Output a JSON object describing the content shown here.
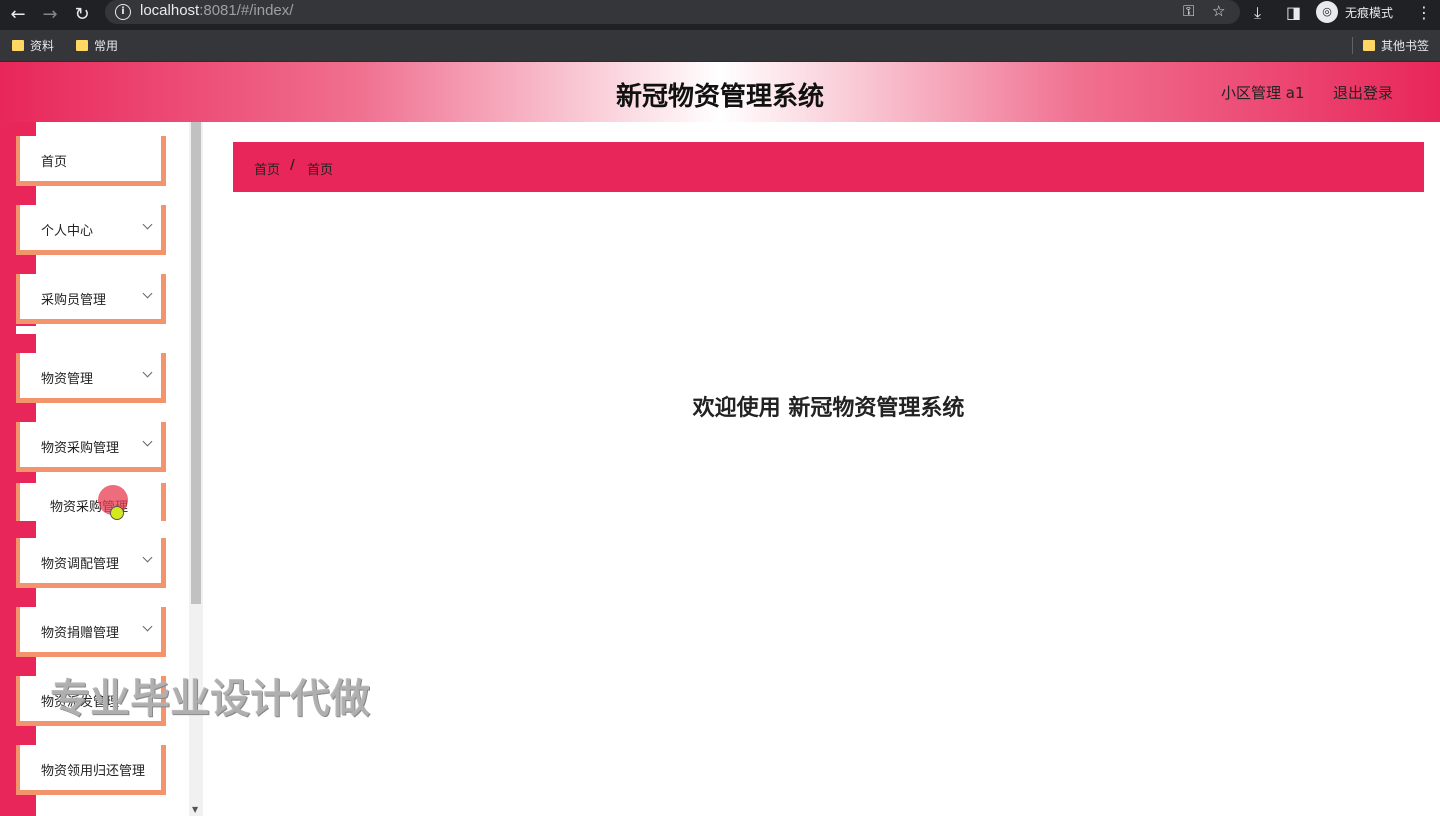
{
  "browser": {
    "url_host": "localhost",
    "url_rest": ":8081/#/index/",
    "incognito_label": "无痕模式",
    "bookmarks": [
      "资料",
      "常用"
    ],
    "other_bookmarks": "其他书签"
  },
  "header": {
    "title": "新冠物资管理系统",
    "user": "小区管理 a1",
    "logout": "退出登录"
  },
  "sidebar": {
    "items": [
      {
        "label": "首页"
      },
      {
        "label": "个人中心"
      },
      {
        "label": "采购员管理"
      },
      {
        "label": "物资管理"
      },
      {
        "label": "物资采购管理"
      },
      {
        "label": "物资采购管理"
      },
      {
        "label": "物资调配管理"
      },
      {
        "label": "物资捐赠管理"
      },
      {
        "label": "物资派发管理"
      },
      {
        "label": "物资领用归还管理"
      }
    ]
  },
  "breadcrumb": [
    "首页",
    "首页"
  ],
  "main": {
    "welcome": "欢迎使用 新冠物资管理系统"
  },
  "watermark": "专业毕业设计代做",
  "colors": {
    "accent": "#e8265a",
    "menu_border": "#f3946c"
  }
}
